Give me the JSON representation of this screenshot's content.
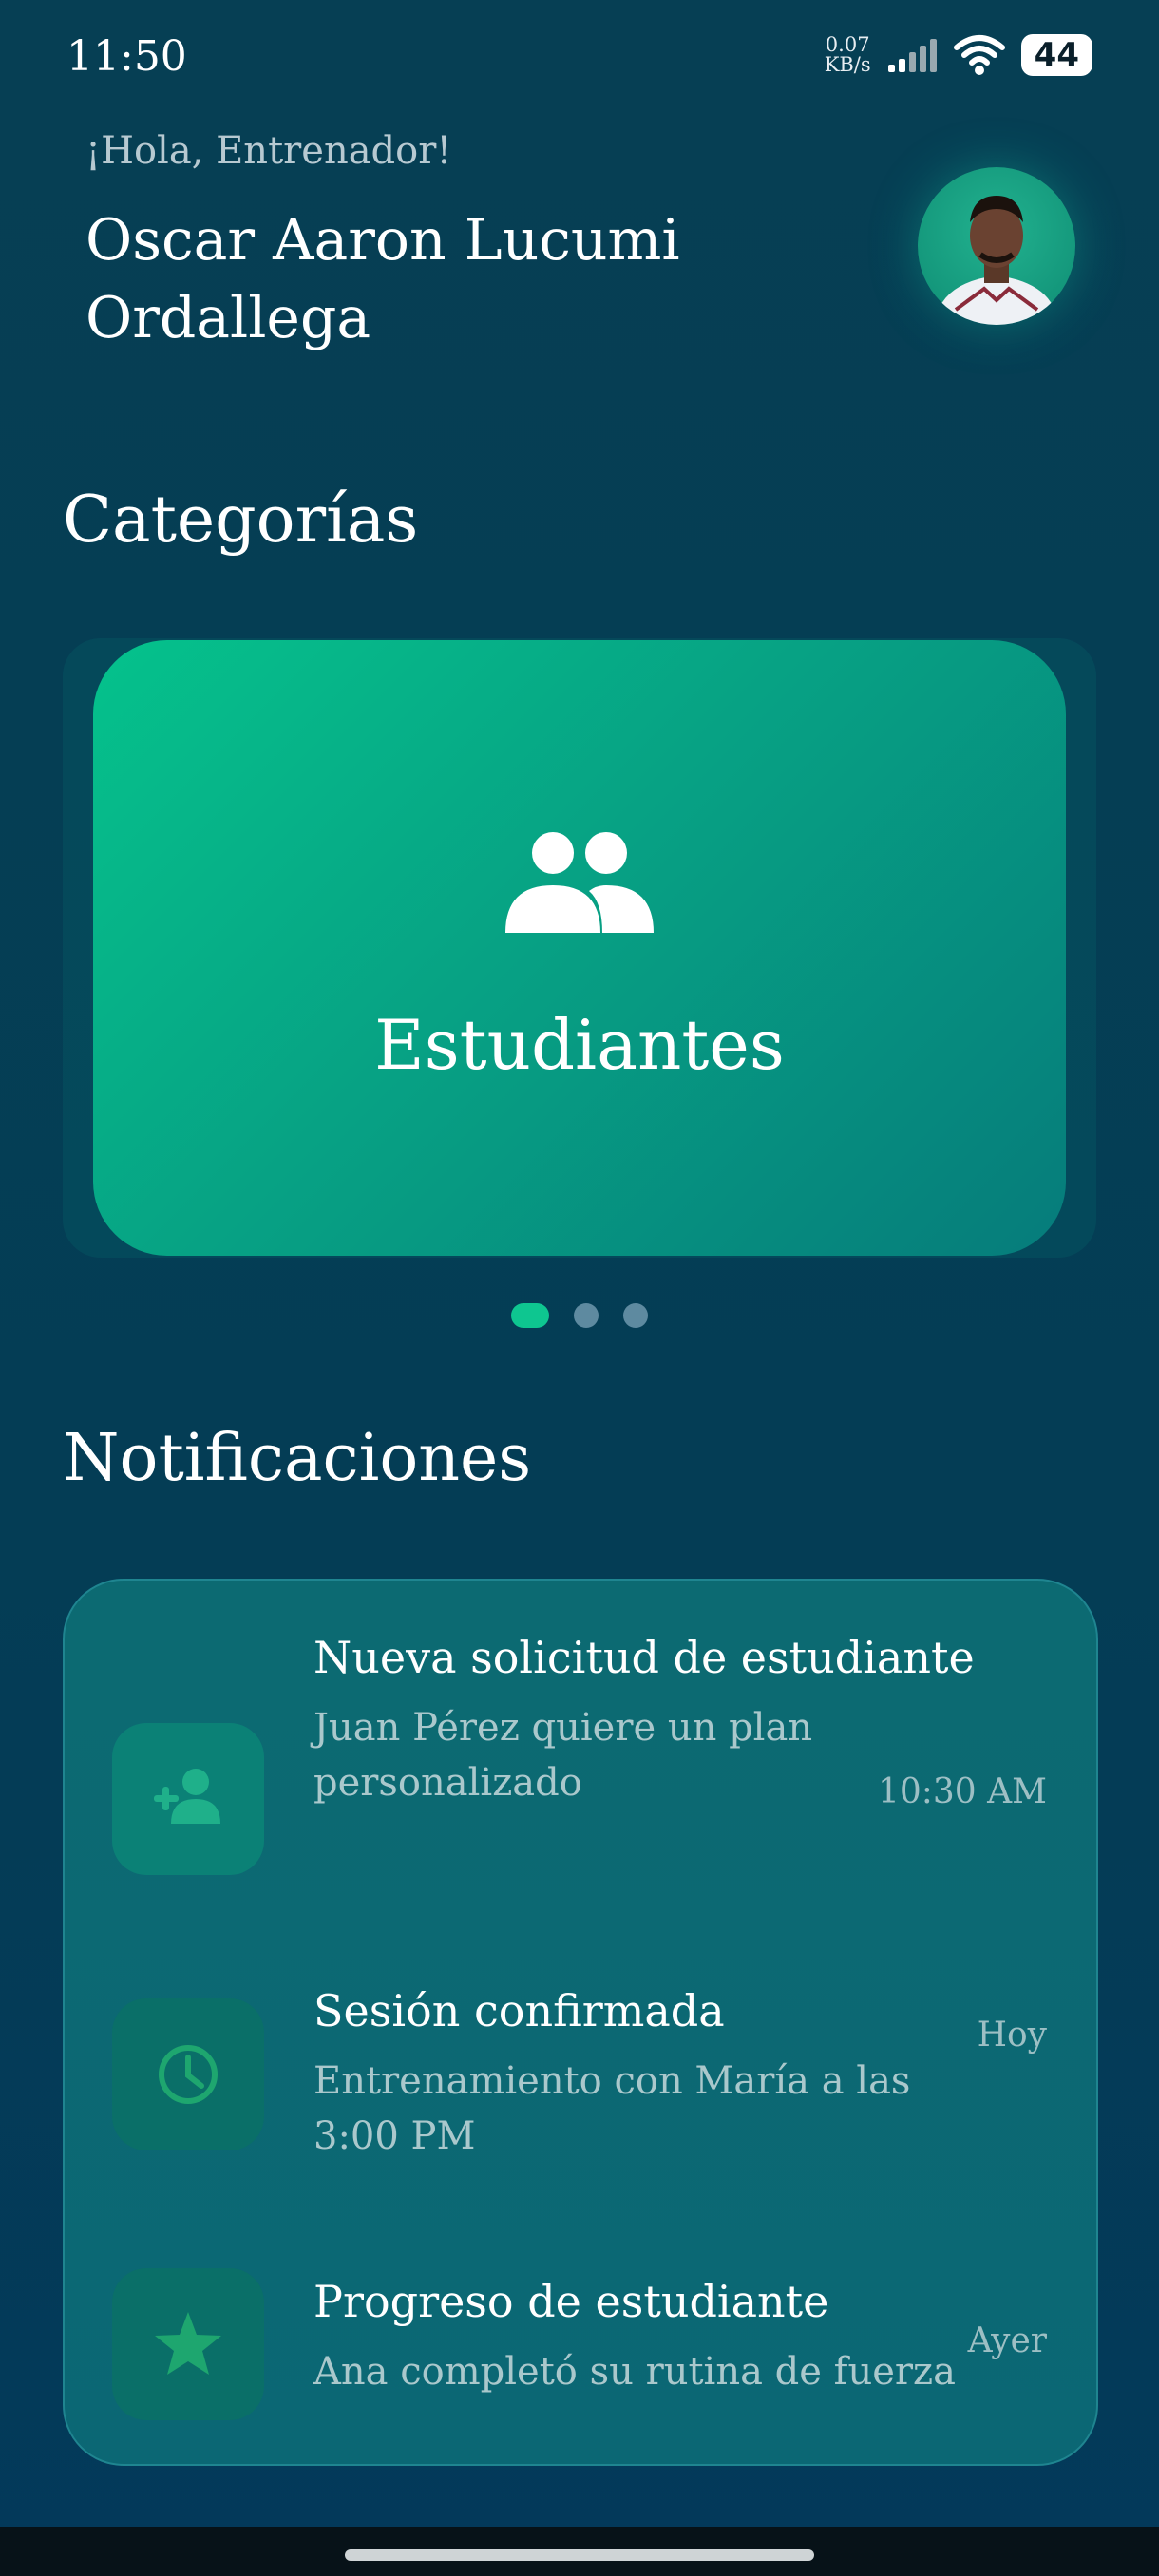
{
  "status_bar": {
    "time": "11:50",
    "net_speed_value": "0.07",
    "net_speed_unit": "KB/s",
    "battery": "44",
    "icons": [
      "signal-icon",
      "wifi-icon",
      "battery-icon"
    ]
  },
  "header": {
    "greeting": "¡Hola, Entrenador!",
    "coach_name": "Oscar Aaron Lucumi Ordallega",
    "avatar_icon": "avatar"
  },
  "categories": {
    "title": "Categorías",
    "cards": [
      {
        "label": "Estudiantes",
        "icon": "group-icon"
      }
    ],
    "carousel_dots": {
      "count": 3,
      "active_index": 0
    }
  },
  "notifications": {
    "title": "Notificaciones",
    "items": [
      {
        "title": "Nueva solicitud de estudiante",
        "body": "Juan Pérez quiere un plan personalizado",
        "time": "10:30 AM",
        "icon": "person-add-icon"
      },
      {
        "title": "Sesión confirmada",
        "body": "Entrenamiento con María a las 3:00 PM",
        "time": "Hoy",
        "icon": "clock-icon"
      },
      {
        "title": "Progreso de estudiante",
        "body": "Ana completó su rutina de fuerza",
        "time": "Ayer",
        "icon": "star-icon"
      }
    ]
  },
  "colors": {
    "background": "#043d55",
    "accent": "#0ec690",
    "card_gradient_start": "#05c28c",
    "card_gradient_end": "#067c7b",
    "notification_card": "#0c6a72",
    "icon_green": "#1ea66f"
  }
}
